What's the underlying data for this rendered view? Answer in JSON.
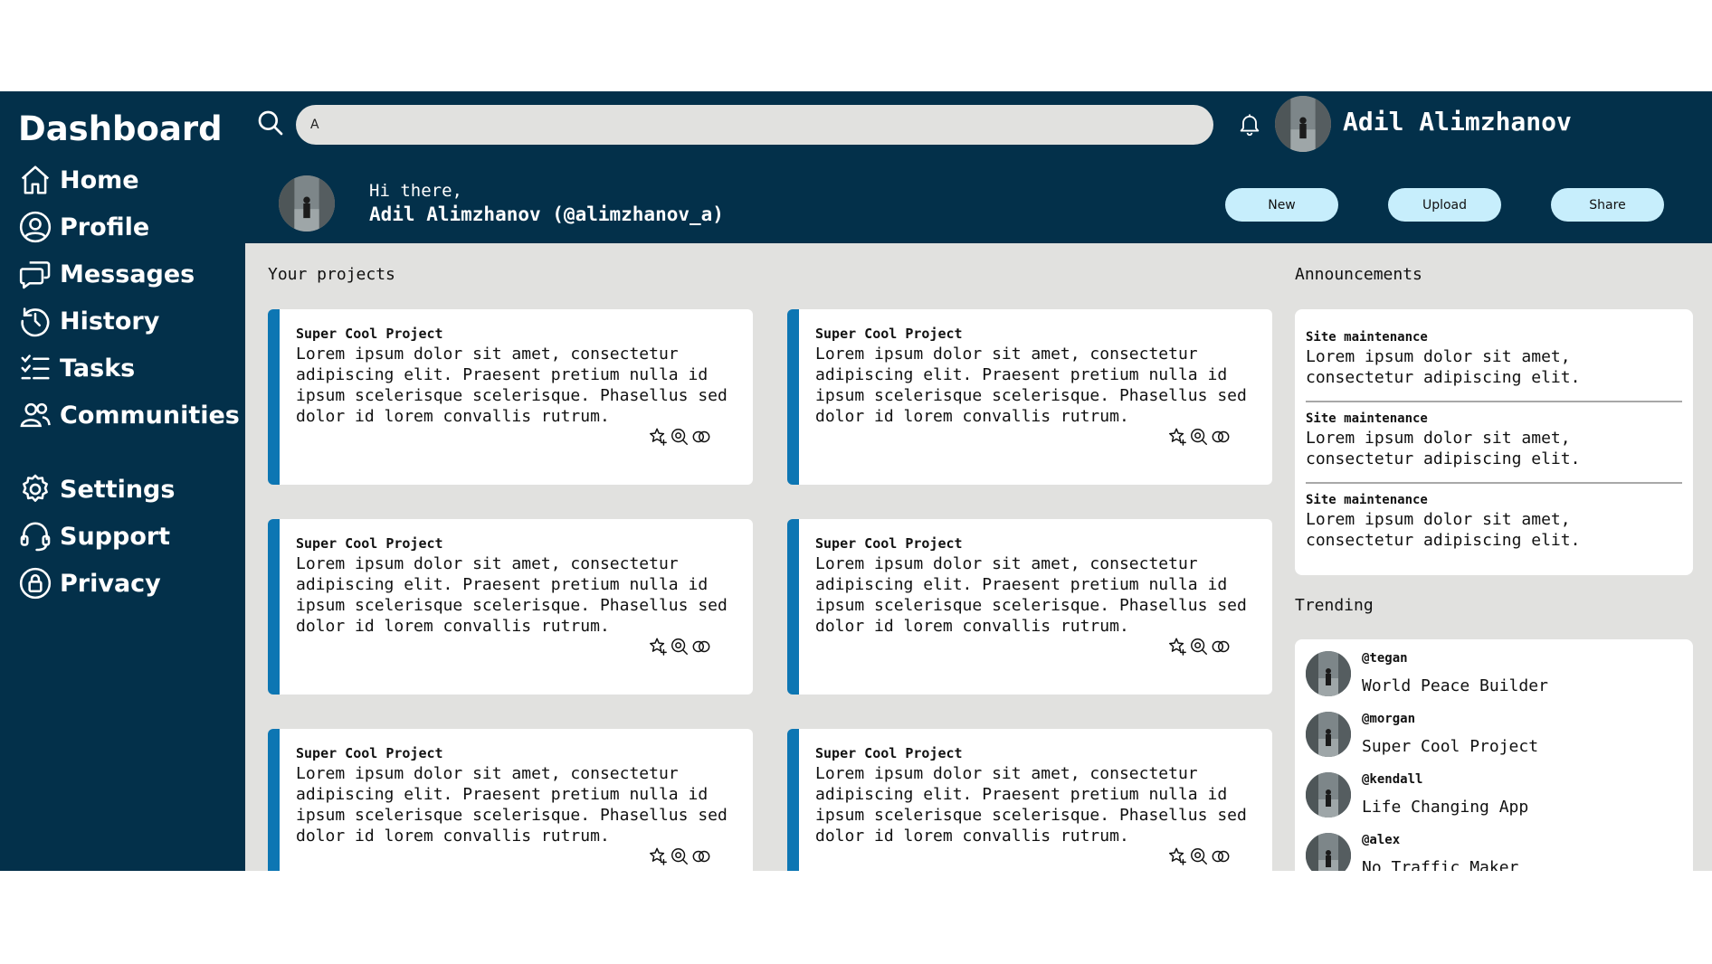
{
  "sidebar": {
    "brand": "Dashboard",
    "nav": [
      {
        "label": "Home",
        "icon": "home-icon"
      },
      {
        "label": "Profile",
        "icon": "user-circle-icon"
      },
      {
        "label": "Messages",
        "icon": "chat-icon"
      },
      {
        "label": "History",
        "icon": "history-icon"
      },
      {
        "label": "Tasks",
        "icon": "checklist-icon"
      },
      {
        "label": "Communities",
        "icon": "users-icon"
      }
    ],
    "secondary": [
      {
        "label": "Settings",
        "icon": "gear-icon"
      },
      {
        "label": "Support",
        "icon": "headset-icon"
      },
      {
        "label": "Privacy",
        "icon": "lock-icon"
      }
    ]
  },
  "header": {
    "search_value": "A",
    "user_name": "Adil Alimzhanov",
    "greeting": "Hi there,",
    "greeting_name": "Adil Alimzhanov (@alimzhanov_a)",
    "actions": {
      "new": "New",
      "upload": "Upload",
      "share": "Share"
    }
  },
  "projects": {
    "title": "Your projects",
    "items": [
      {
        "title": "Super Cool Project",
        "description": "Lorem ipsum dolor sit amet, consectetur adipiscing elit. Praesent pretium nulla id ipsum scelerisque scelerisque. Phasellus sed dolor id lorem convallis rutrum."
      },
      {
        "title": "Super Cool Project",
        "description": "Lorem ipsum dolor sit amet, consectetur adipiscing elit. Praesent pretium nulla id ipsum scelerisque scelerisque. Phasellus sed dolor id lorem convallis rutrum."
      },
      {
        "title": "Super Cool Project",
        "description": "Lorem ipsum dolor sit amet, consectetur adipiscing elit. Praesent pretium nulla id ipsum scelerisque scelerisque. Phasellus sed dolor id lorem convallis rutrum."
      },
      {
        "title": "Super Cool Project",
        "description": "Lorem ipsum dolor sit amet, consectetur adipiscing elit. Praesent pretium nulla id ipsum scelerisque scelerisque. Phasellus sed dolor id lorem convallis rutrum."
      },
      {
        "title": "Super Cool Project",
        "description": "Lorem ipsum dolor sit amet, consectetur adipiscing elit. Praesent pretium nulla id ipsum scelerisque scelerisque. Phasellus sed dolor id lorem convallis rutrum."
      },
      {
        "title": "Super Cool Project",
        "description": "Lorem ipsum dolor sit amet, consectetur adipiscing elit. Praesent pretium nulla id ipsum scelerisque scelerisque. Phasellus sed dolor id lorem convallis rutrum."
      }
    ],
    "card_actions": [
      "star-add-icon",
      "watch-icon",
      "share-link-icon"
    ]
  },
  "announcements": {
    "title": "Announcements",
    "items": [
      {
        "title": "Site maintenance",
        "body": "Lorem ipsum dolor sit amet, consectetur adipiscing elit."
      },
      {
        "title": "Site maintenance",
        "body": "Lorem ipsum dolor sit amet, consectetur adipiscing elit."
      },
      {
        "title": "Site maintenance",
        "body": "Lorem ipsum dolor sit amet, consectetur adipiscing elit."
      }
    ]
  },
  "trending": {
    "title": "Trending",
    "items": [
      {
        "handle": "@tegan",
        "project": "World Peace Builder"
      },
      {
        "handle": "@morgan",
        "project": "Super Cool Project"
      },
      {
        "handle": "@kendall",
        "project": "Life Changing App"
      },
      {
        "handle": "@alex",
        "project": "No Traffic Maker"
      }
    ]
  },
  "colors": {
    "navy": "#03304a",
    "background": "#e1e1df",
    "accent_blue": "#0d76b3",
    "button_light": "#c7eefc",
    "card": "#ffffff"
  }
}
